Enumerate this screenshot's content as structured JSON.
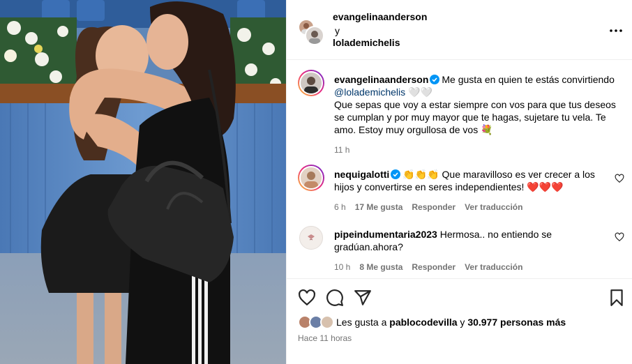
{
  "post": {
    "owner_primary": "evangelinaanderson",
    "joiner": "y",
    "owner_secondary": "lolademichelis",
    "more_icon": "more-horizontal-icon"
  },
  "caption": {
    "username": "evangelinaanderson",
    "line1": "Me gusta en quien te estás convirtiendo",
    "mention": "@lolademichelis",
    "mention_suffix": "🤍🤍",
    "line2": "Que sepas que voy a estar siempre con vos para que tus deseos se cumplan y por muy mayor que te hagas, sujetare tu vela. Te amo. Estoy muy orgullosa de vos",
    "emoji": "💐",
    "time": "11 h"
  },
  "comments": [
    {
      "username": "nequigalotti",
      "text_prefix": "👏👏👏",
      "text": "Que maravilloso es ver crecer a los hijos y convertirse en seres independientes!",
      "text_suffix": "❤️❤️❤️",
      "time": "6 h",
      "likes": "17 Me gusta",
      "reply": "Responder",
      "translate": "Ver traducción"
    },
    {
      "username": "pipeindumentaria2023",
      "text": "Hermosa.. no entiendo se gradúan.ahora?",
      "time": "10 h",
      "likes": "8 Me gusta",
      "reply": "Responder",
      "translate": "Ver traducción"
    }
  ],
  "footer": {
    "likes_prefix": "Les gusta a",
    "likes_user": "pablocodevilla",
    "likes_join": "y",
    "likes_count": "30.977 personas más",
    "timestamp": "Hace 11 horas"
  },
  "colors": {
    "link": "#00376b",
    "muted": "#737373",
    "verified": "#0095f6",
    "divider": "#efefef"
  }
}
